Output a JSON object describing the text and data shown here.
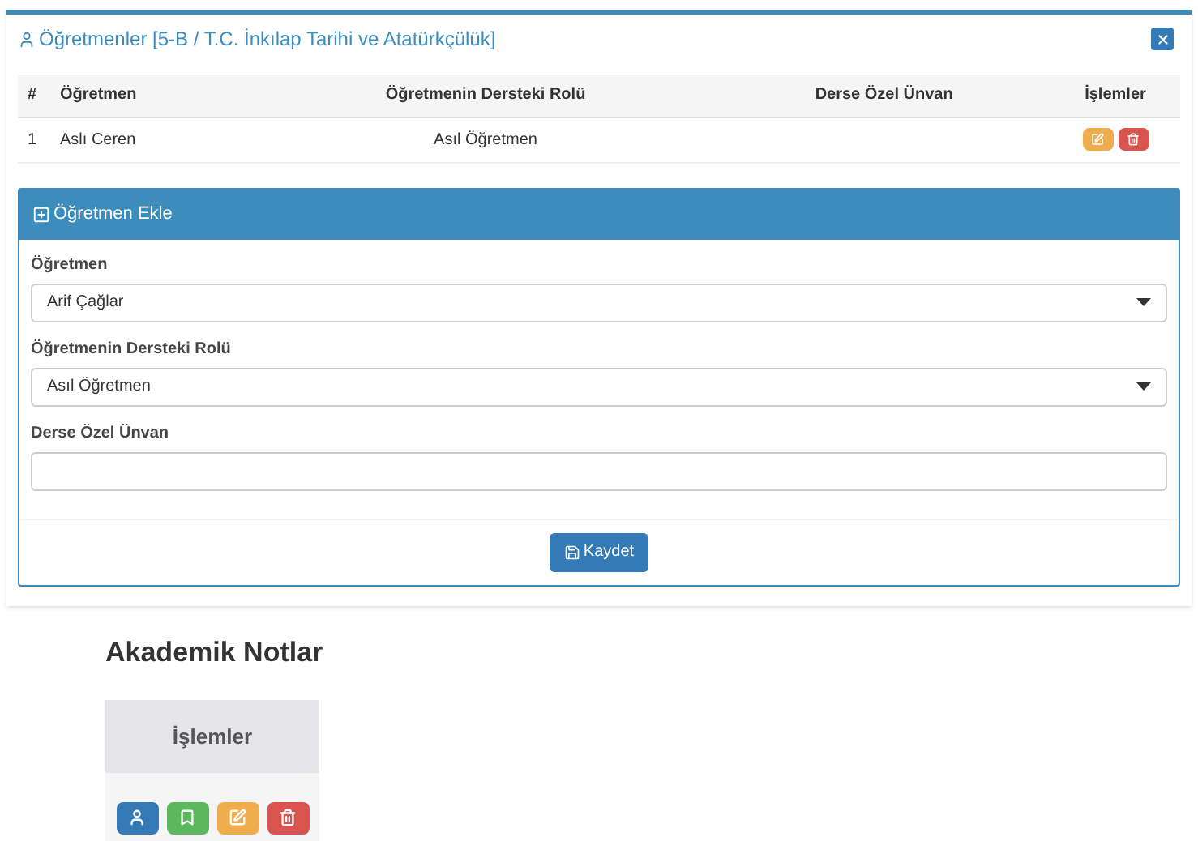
{
  "modal": {
    "title": "Öğretmenler [5-B / T.C. İnkılap Tarihi ve Atatürkçülük]"
  },
  "table": {
    "columns": [
      "#",
      "Öğretmen",
      "Öğretmenin Dersteki Rolü",
      "Derse Özel Ünvan",
      "İşlemler"
    ],
    "rows": [
      {
        "cells": [
          "1",
          "Aslı Ceren",
          "Asıl Öğretmen",
          ""
        ],
        "actions": [
          {
            "kind": "edit"
          },
          {
            "kind": "delete"
          }
        ]
      }
    ]
  },
  "panel": {
    "title": "Öğretmen Ekle",
    "fields": [
      {
        "kind": "select",
        "label": "Öğretmen",
        "value": "Arif Çağlar"
      },
      {
        "kind": "select",
        "label": "Öğretmenin Dersteki Rolü",
        "value": "Asıl Öğretmen"
      },
      {
        "kind": "text",
        "label": "Derse Özel Ünvan"
      }
    ],
    "save_button": "Kaydet"
  },
  "section": {
    "title": "Akademik Notlar",
    "card_header": "İşlemler",
    "actions": [
      {
        "kind": "teacher"
      },
      {
        "kind": "bookmark"
      },
      {
        "kind": "edit"
      },
      {
        "kind": "delete"
      }
    ]
  }
}
